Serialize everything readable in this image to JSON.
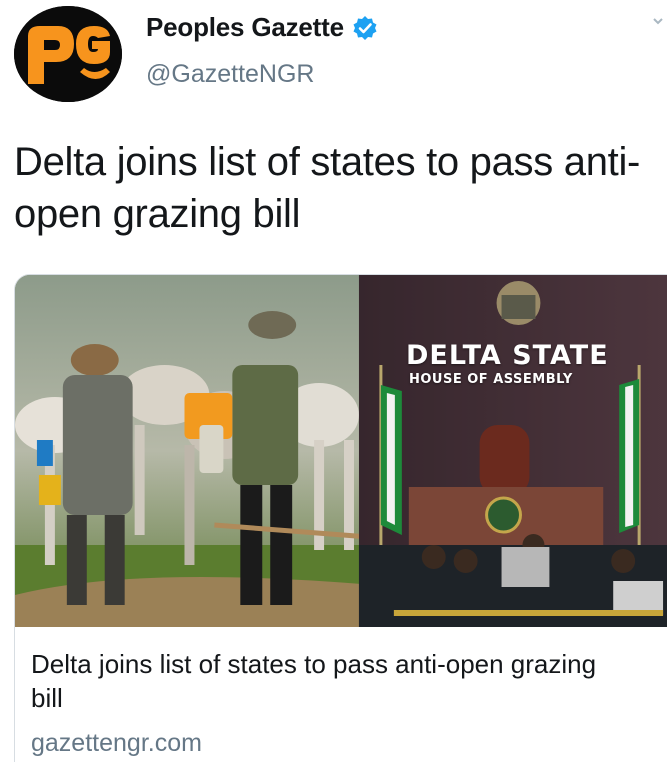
{
  "account": {
    "display_name": "Peoples Gazette",
    "handle": "@GazetteNGR",
    "avatar_logo": "pg",
    "verified": true
  },
  "tweet": {
    "text": "Delta joins list of states to pass anti-open grazing bill"
  },
  "link_card": {
    "title": "Delta joins list of states to pass anti-open grazing bill",
    "domain": "gazettengr.com",
    "image": {
      "sign_title": "DELTA STATE",
      "sign_subtitle": "HOUSE OF ASSEMBLY"
    }
  },
  "icons": {
    "verified": "verified-badge-icon",
    "more": "chevron-down-icon"
  },
  "colors": {
    "avatar_bg": "#0b0b0b",
    "logo": "#f7941d",
    "verified": "#1da1f2",
    "secondary_text": "#657786"
  }
}
